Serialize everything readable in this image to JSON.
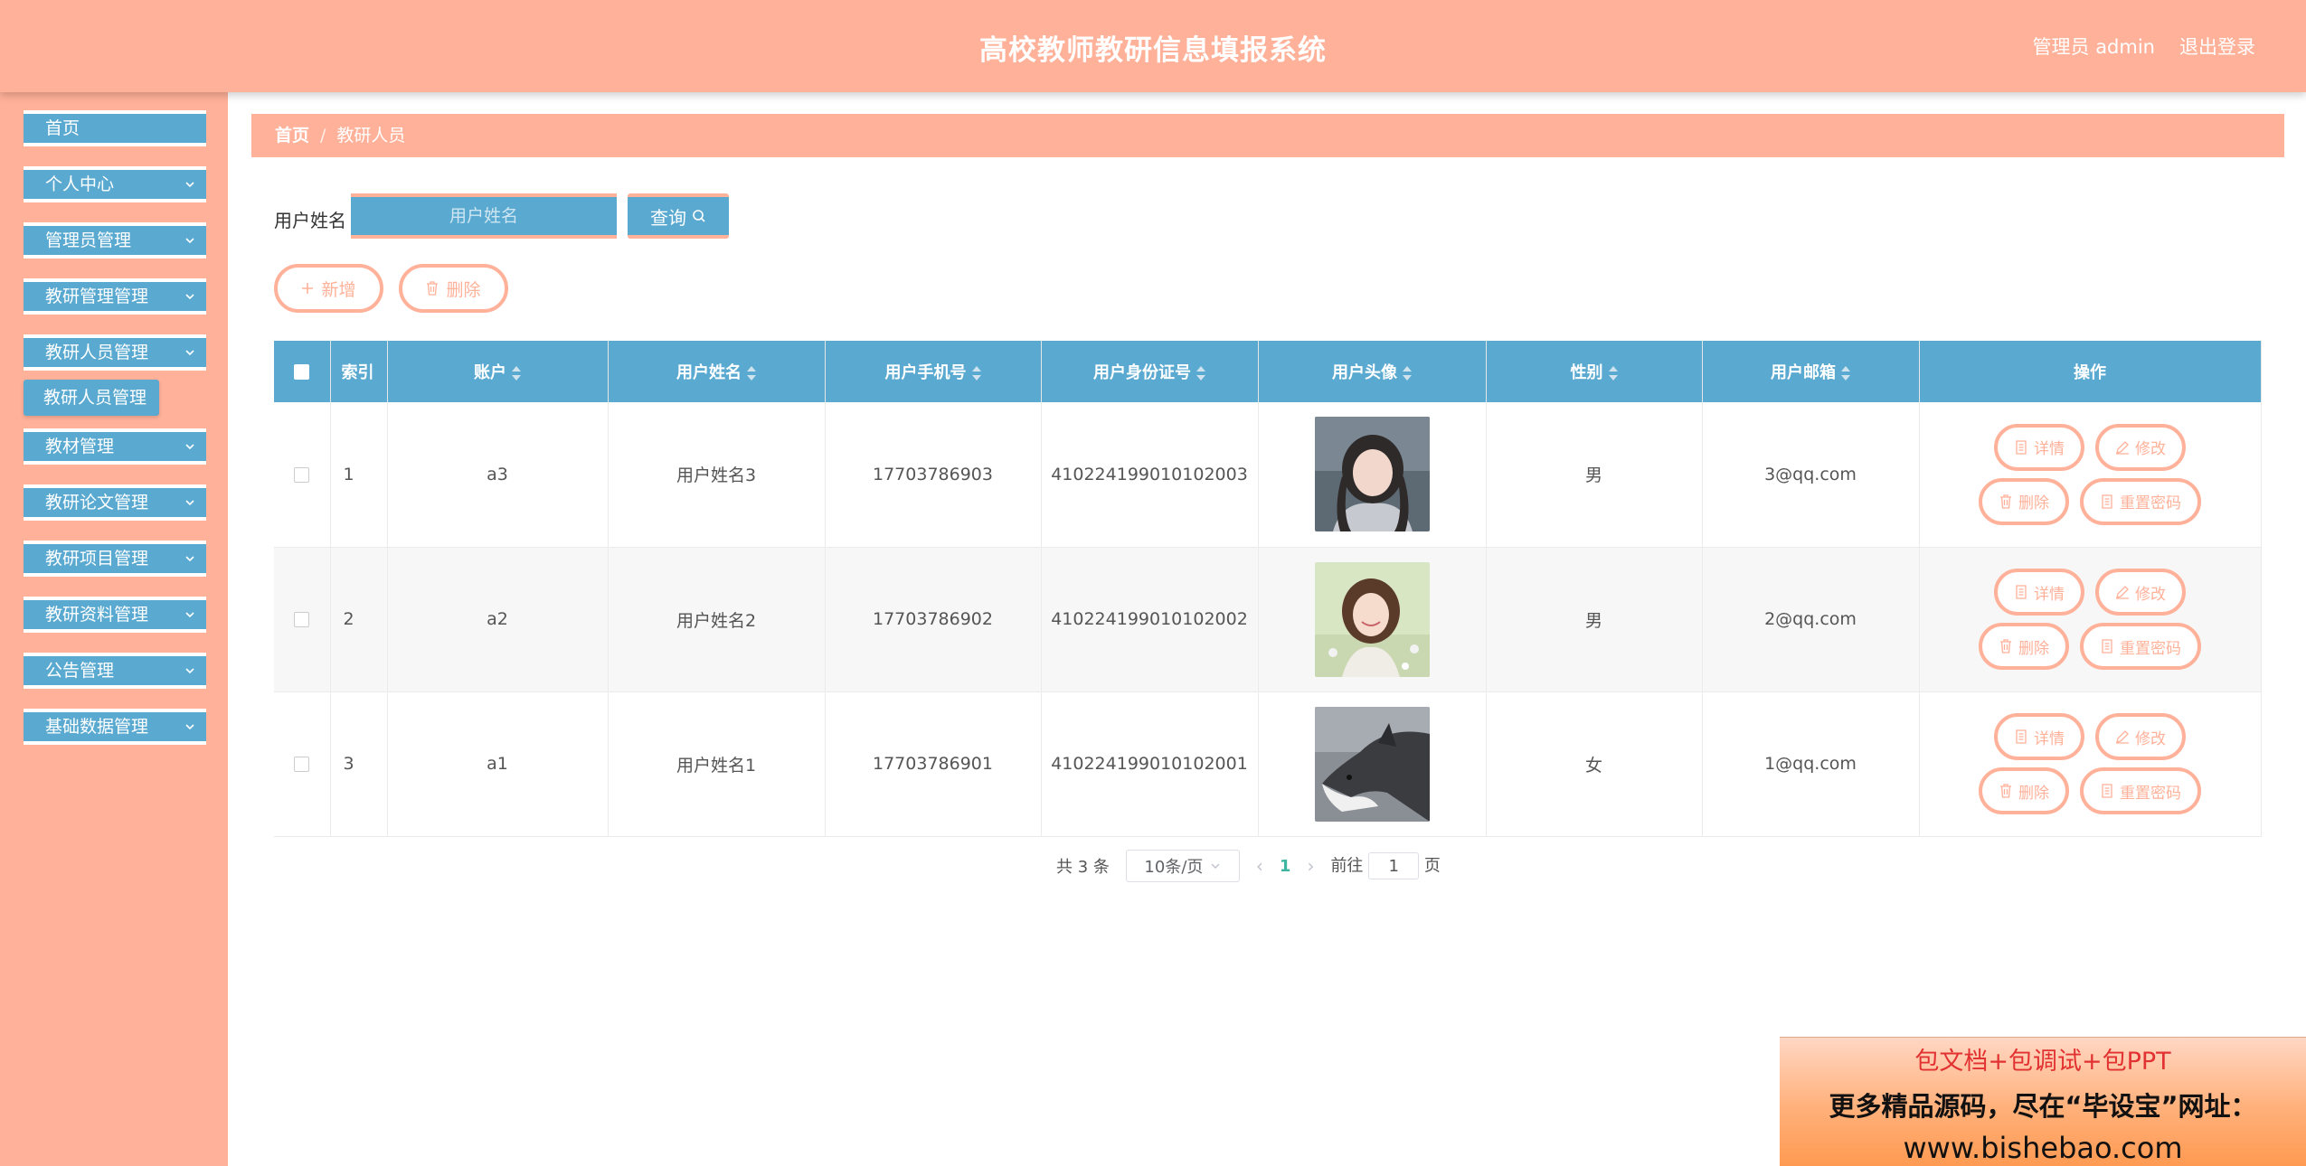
{
  "header": {
    "title": "高校教师教研信息填报系统",
    "user": "管理员 admin",
    "logout": "退出登录"
  },
  "sidebar": {
    "items": [
      {
        "label": "首页",
        "has_children": false
      },
      {
        "label": "个人中心",
        "has_children": true
      },
      {
        "label": "管理员管理",
        "has_children": true
      },
      {
        "label": "教研管理管理",
        "has_children": true
      },
      {
        "label": "教研人员管理",
        "has_children": true
      },
      {
        "label": "教材管理",
        "has_children": true
      },
      {
        "label": "教研论文管理",
        "has_children": true
      },
      {
        "label": "教研项目管理",
        "has_children": true
      },
      {
        "label": "教研资料管理",
        "has_children": true
      },
      {
        "label": "公告管理",
        "has_children": true
      },
      {
        "label": "基础数据管理",
        "has_children": true
      }
    ],
    "sub_item": "教研人员管理"
  },
  "breadcrumb": {
    "home": "首页",
    "sep": "/",
    "current": "教研人员"
  },
  "search": {
    "label": "用户姓名",
    "placeholder": "用户姓名",
    "button": "查询"
  },
  "actions": {
    "add": "新增",
    "delete": "删除"
  },
  "table": {
    "headers": [
      "索引",
      "账户",
      "用户姓名",
      "用户手机号",
      "用户身份证号",
      "用户头像",
      "性别",
      "用户邮箱",
      "操作"
    ],
    "rows": [
      {
        "index": "1",
        "account": "a3",
        "name": "用户姓名3",
        "phone": "17703786903",
        "id_card": "410224199010102003",
        "gender": "男",
        "email": "3@qq.com"
      },
      {
        "index": "2",
        "account": "a2",
        "name": "用户姓名2",
        "phone": "17703786902",
        "id_card": "410224199010102002",
        "gender": "男",
        "email": "2@qq.com"
      },
      {
        "index": "3",
        "account": "a1",
        "name": "用户姓名1",
        "phone": "17703786901",
        "id_card": "410224199010102001",
        "gender": "女",
        "email": "1@qq.com"
      }
    ],
    "ops": {
      "detail": "详情",
      "edit": "修改",
      "delete": "删除",
      "reset": "重置密码"
    }
  },
  "pagination": {
    "total": "共 3 条",
    "page_size": "10条/页",
    "current": "1",
    "goto_prefix": "前往",
    "goto_value": "1",
    "goto_suffix": "页"
  },
  "ad": {
    "line1": "包文档+包调试+包PPT",
    "line2": "更多精品源码，尽在“毕设宝”网址：",
    "line3": "www.bishebao.com"
  },
  "colors": {
    "primary": "#5aa9d0",
    "accent": "#ffb199",
    "active_page": "#3db5a0"
  }
}
